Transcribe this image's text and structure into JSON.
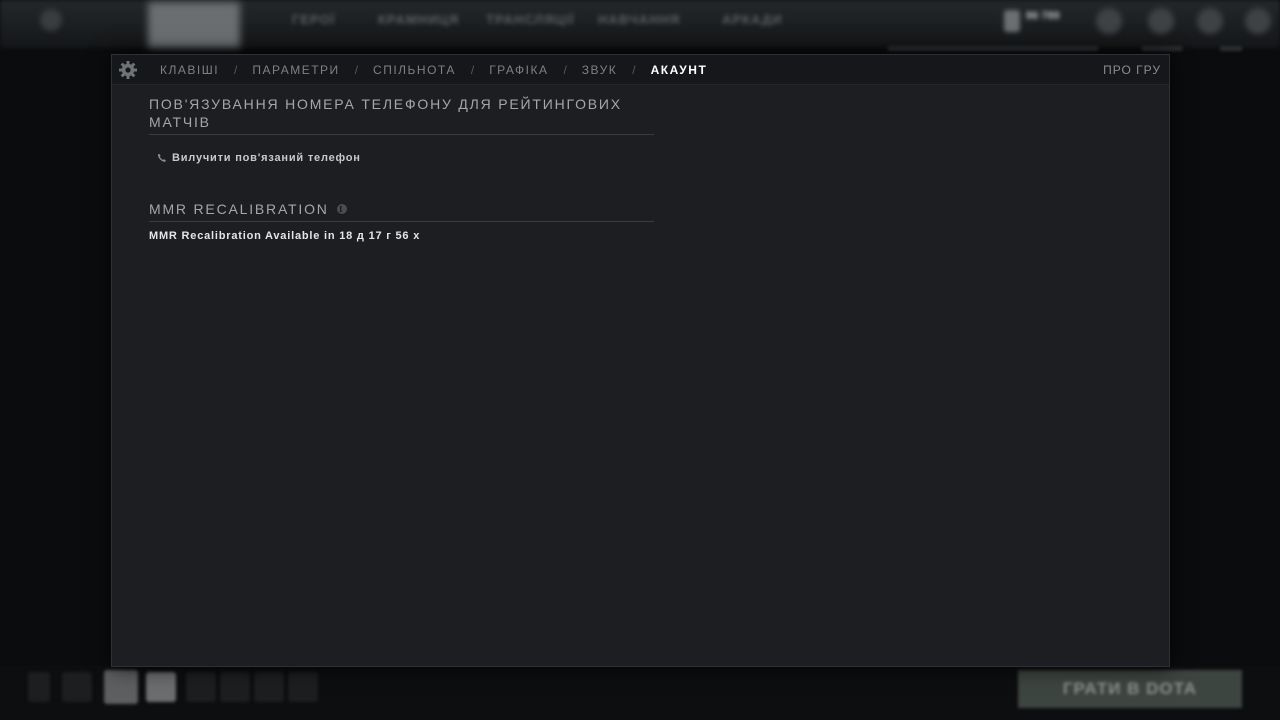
{
  "background": {
    "nav": [
      "ГЕРОЇ",
      "КРАМНИЦЯ",
      "ТРАНСЛЯЦІЇ",
      "НАВЧАННЯ",
      "АРКАДИ"
    ],
    "shards": "86 789",
    "play_button": "ГРАТИ В DOTA"
  },
  "settings": {
    "tabs": [
      {
        "label": "КЛАВІШІ"
      },
      {
        "label": "ПАРАМЕТРИ"
      },
      {
        "label": "СПІЛЬНОТА"
      },
      {
        "label": "ГРАФІКА"
      },
      {
        "label": "ЗВУК"
      },
      {
        "label": "АКАУНТ"
      }
    ],
    "separator": "/",
    "active_tab": "АКАУНТ",
    "about_label": "ПРО ГРУ",
    "phone_section": {
      "title": "ПОВ'ЯЗУВАННЯ НОМЕРА ТЕЛЕФОНУ ДЛЯ РЕЙТИНГОВИХ МАТЧІВ",
      "unlink_label": "Вилучити пов'язаний телефон"
    },
    "mmr_section": {
      "title": "MMR RECALIBRATION",
      "status": "MMR Recalibration Available in 18 д 17 г 56 х"
    }
  },
  "icons": {
    "settings": "gear-icon",
    "phone": "phone-icon",
    "info": "info-icon"
  }
}
